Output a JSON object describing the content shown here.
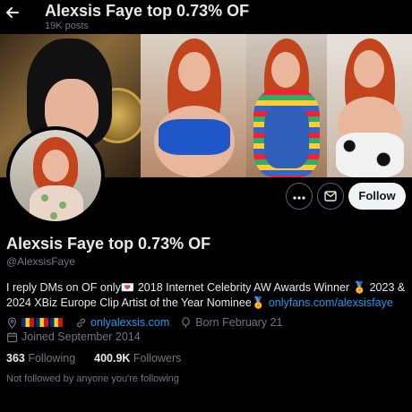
{
  "header": {
    "back_icon": "arrow-left-icon",
    "title": "Alexsis Faye top 0.73% OF",
    "post_count": "19K posts"
  },
  "profile": {
    "display_name": "Alexsis Faye top 0.73% OF",
    "handle": "@AlexsisFaye",
    "bio_part1": "I reply DMs on OF only💌  2018 Internet Celebrity AW Awards Winner 🏅 2023 & 2024 XBiz Europe Clip Artist of the Year Nominee🏅 ",
    "bio_link": "onlyfans.com/alexsisfaye",
    "location_flags": "🇷🇴🇷🇴🇷🇴",
    "website": "onlyalexsis.com",
    "birthday": "Born February 21",
    "joined": "Joined September 2014",
    "following_count": "363",
    "following_label": "Following",
    "followers_count": "400.9K",
    "followers_label": "Followers",
    "not_followed_text": "Not followed by anyone you're following"
  },
  "actions": {
    "more_icon": "more-icon",
    "message_icon": "envelope-icon",
    "follow_label": "Follow"
  },
  "colors": {
    "background": "#000000",
    "text_primary": "#e7e9ea",
    "text_secondary": "#71767b",
    "link": "#1d9bf0",
    "follow_button_bg": "#eff3f4"
  }
}
